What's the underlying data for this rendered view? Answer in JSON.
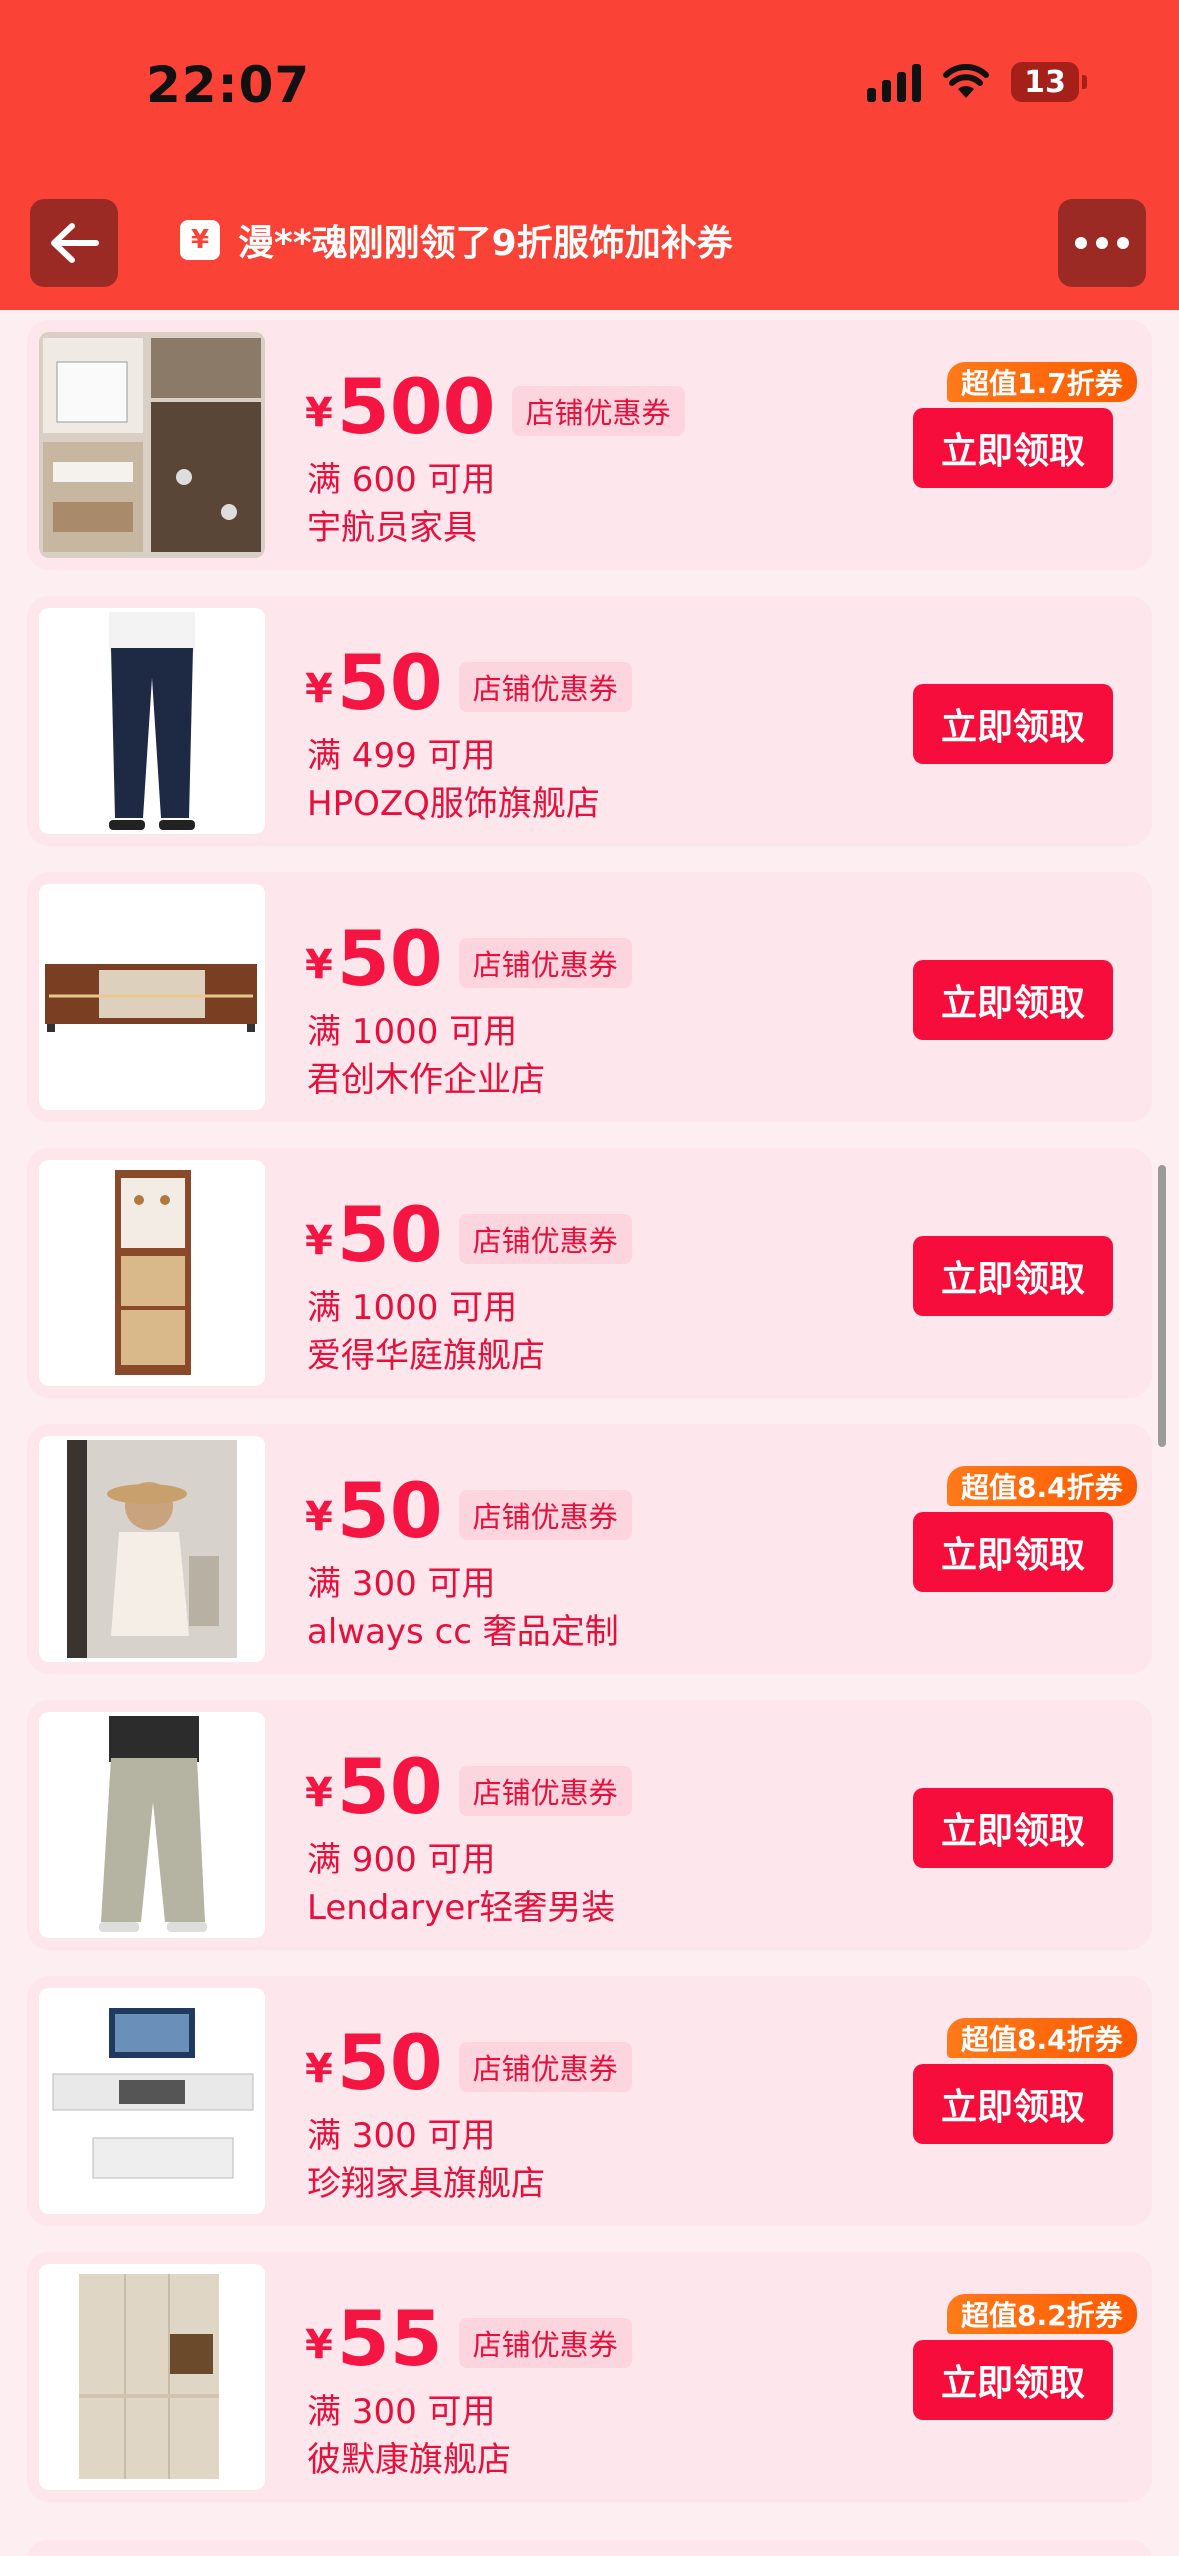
{
  "status_bar": {
    "time": "22:07",
    "battery": "13"
  },
  "nav": {
    "title": "漫**魂刚刚领了9折服饰加补券",
    "gift_icon_text": "¥"
  },
  "coupon_list": [
    {
      "yen": "¥",
      "amount": "500",
      "tag": "店铺优惠券",
      "condition": "满 600 可用",
      "shop": "宇航员家具",
      "badge": "超值1.7折券",
      "button": "立即领取",
      "image": "shoe-cabinet-interior"
    },
    {
      "yen": "¥",
      "amount": "50",
      "tag": "店铺优惠券",
      "condition": "满 499 可用",
      "shop": "HPOZQ服饰旗舰店",
      "badge": "",
      "button": "立即领取",
      "image": "navy-trousers"
    },
    {
      "yen": "¥",
      "amount": "50",
      "tag": "店铺优惠券",
      "condition": "满 1000 可用",
      "shop": "君创木作企业店",
      "badge": "",
      "button": "立即领取",
      "image": "tv-stand"
    },
    {
      "yen": "¥",
      "amount": "50",
      "tag": "店铺优惠券",
      "condition": "满 1000 可用",
      "shop": "爱得华庭旗舰店",
      "badge": "",
      "button": "立即领取",
      "image": "entry-cabinet"
    },
    {
      "yen": "¥",
      "amount": "50",
      "tag": "店铺优惠券",
      "condition": "满 300 可用",
      "shop": "always cc 奢品定制",
      "badge": "超值8.4折券",
      "button": "立即领取",
      "image": "fashion-model"
    },
    {
      "yen": "¥",
      "amount": "50",
      "tag": "店铺优惠券",
      "condition": "满 900 可用",
      "shop": "Lendaryer轻奢男装",
      "badge": "",
      "button": "立即领取",
      "image": "grey-trousers"
    },
    {
      "yen": "¥",
      "amount": "50",
      "tag": "店铺优惠券",
      "condition": "满 300 可用",
      "shop": "珍翔家具旗舰店",
      "badge": "超值8.4折券",
      "button": "立即领取",
      "image": "tv-cabinet-set"
    },
    {
      "yen": "¥",
      "amount": "55",
      "tag": "店铺优惠券",
      "condition": "满 300 可用",
      "shop": "彼默康旗舰店",
      "badge": "超值8.2折券",
      "button": "立即领取",
      "image": "wardrobe"
    }
  ],
  "colors": {
    "header": "#fb4236",
    "accent": "#f41543",
    "card_bg": "#fde6ec",
    "badge": "#ff6a0a"
  }
}
